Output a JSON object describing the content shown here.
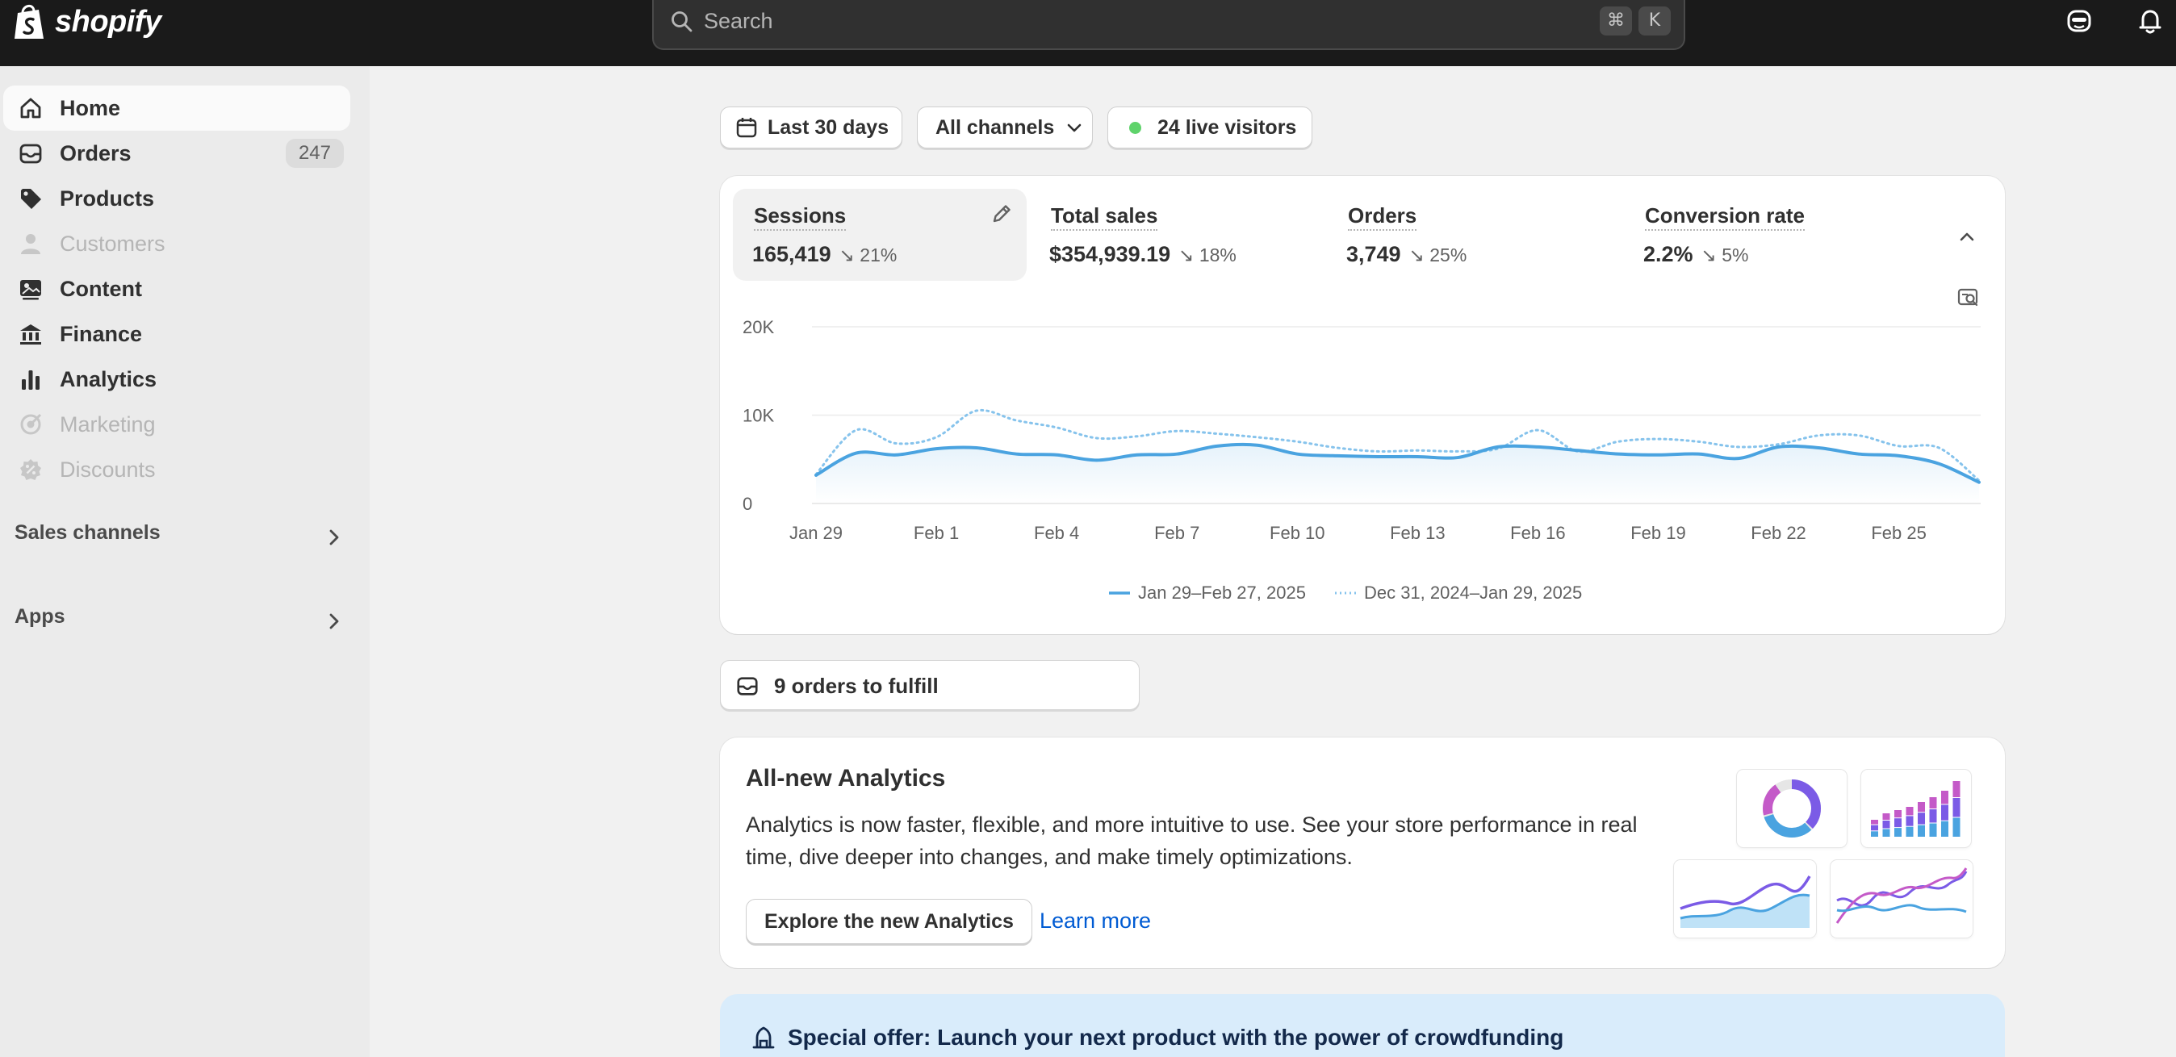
{
  "brand": {
    "name": "shopify"
  },
  "search": {
    "placeholder": "Search",
    "shortcut_keys": [
      "⌘",
      "K"
    ]
  },
  "sidebar": {
    "items": [
      {
        "label": "Home",
        "icon": "home-icon",
        "active": true
      },
      {
        "label": "Orders",
        "icon": "inbox-icon",
        "badge": "247"
      },
      {
        "label": "Products",
        "icon": "tag-icon"
      },
      {
        "label": "Customers",
        "icon": "person-icon",
        "disabled": true
      },
      {
        "label": "Content",
        "icon": "image-icon"
      },
      {
        "label": "Finance",
        "icon": "bank-icon"
      },
      {
        "label": "Analytics",
        "icon": "bar-chart-icon"
      },
      {
        "label": "Marketing",
        "icon": "target-icon",
        "disabled": true
      },
      {
        "label": "Discounts",
        "icon": "discount-icon",
        "disabled": true
      }
    ],
    "sections": [
      {
        "label": "Sales channels"
      },
      {
        "label": "Apps"
      }
    ]
  },
  "filters": {
    "date_range": "Last 30 days",
    "channels": "All channels",
    "live_visitors": "24 live visitors"
  },
  "metrics": [
    {
      "title": "Sessions",
      "value": "165,419",
      "change": "21%",
      "active": true
    },
    {
      "title": "Total sales",
      "value": "$354,939.19",
      "change": "18%"
    },
    {
      "title": "Orders",
      "value": "3,749",
      "change": "25%"
    },
    {
      "title": "Conversion rate",
      "value": "2.2%",
      "change": "5%"
    }
  ],
  "chart_data": {
    "type": "line",
    "x": [
      "Jan 29",
      "Jan 30",
      "Jan 31",
      "Feb 1",
      "Feb 2",
      "Feb 3",
      "Feb 4",
      "Feb 5",
      "Feb 6",
      "Feb 7",
      "Feb 8",
      "Feb 9",
      "Feb 10",
      "Feb 11",
      "Feb 12",
      "Feb 13",
      "Feb 14",
      "Feb 15",
      "Feb 16",
      "Feb 17",
      "Feb 18",
      "Feb 19",
      "Feb 20",
      "Feb 21",
      "Feb 22",
      "Feb 23",
      "Feb 24",
      "Feb 25",
      "Feb 26",
      "Feb 27"
    ],
    "x_tick_labels": [
      "Jan 29",
      "Feb 1",
      "Feb 4",
      "Feb 7",
      "Feb 10",
      "Feb 13",
      "Feb 16",
      "Feb 19",
      "Feb 22",
      "Feb 25"
    ],
    "y_tick_labels": [
      "0",
      "10K",
      "20K"
    ],
    "ylim": [
      0,
      20000
    ],
    "series": [
      {
        "name": "Jan 29–Feb 27, 2025",
        "style": "solid",
        "color": "#4aa3e0",
        "values": [
          3200,
          5700,
          5500,
          6200,
          6300,
          5600,
          5500,
          4900,
          5500,
          5600,
          6500,
          6600,
          5600,
          5400,
          5300,
          5300,
          5200,
          6400,
          6400,
          6000,
          5600,
          5500,
          5600,
          5100,
          6400,
          6300,
          5600,
          5400,
          4500,
          2400
        ]
      },
      {
        "name": "Dec 31, 2024–Jan 29, 2025",
        "style": "dotted",
        "color": "#86c3ec",
        "values": [
          3300,
          8300,
          6800,
          7500,
          10500,
          9400,
          8600,
          7400,
          7600,
          8200,
          7900,
          7500,
          7000,
          6300,
          5900,
          6000,
          5900,
          6200,
          8300,
          5900,
          7000,
          7300,
          7000,
          6400,
          6700,
          7700,
          7700,
          6500,
          6300,
          2600
        ]
      }
    ],
    "grid": true
  },
  "fulfill": {
    "label": "9 orders to fulfill"
  },
  "promo": {
    "title": "All-new Analytics",
    "body": "Analytics is now faster, flexible, and more intuitive to use. See your store performance in real time, dive deeper into changes, and make timely optimizations.",
    "button": "Explore the new Analytics",
    "link": "Learn more"
  },
  "offer": {
    "title": "Special offer: Launch your next product with the power of crowdfunding"
  },
  "colors": {
    "accent_line": "#4aa3e0",
    "live_dot": "#5fd36b",
    "link": "#005bd3",
    "topbar": "#1a1a1a"
  }
}
